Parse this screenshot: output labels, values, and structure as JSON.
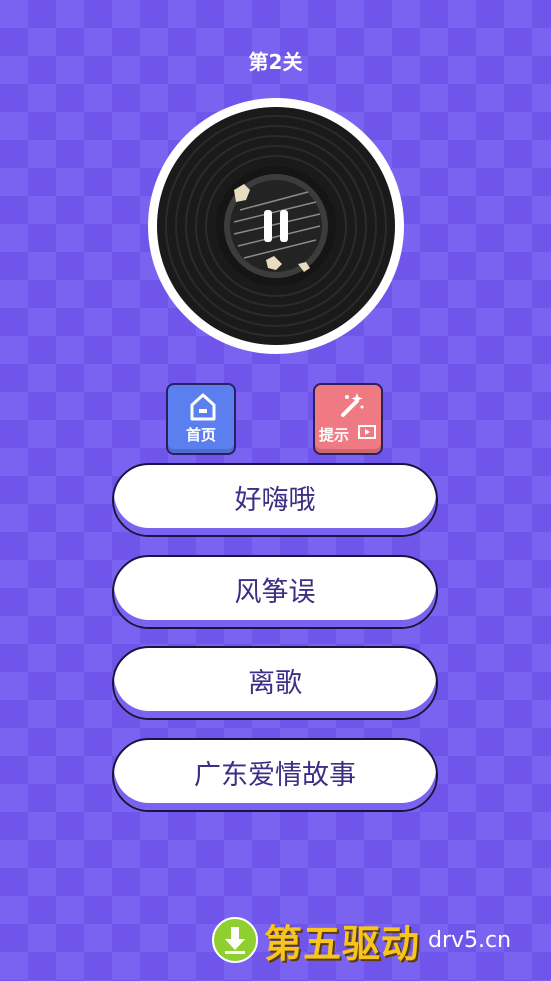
{
  "level_title": "第2关",
  "buttons": {
    "home_label": "首页",
    "hint_label": "提示"
  },
  "answers": [
    "好嗨哦",
    "风筝误",
    "离歌",
    "广东爱情故事"
  ],
  "watermark": {
    "text": "第五驱动",
    "domain": "drv5.cn"
  },
  "colors": {
    "background": "#7b63f2",
    "home_button": "#5c7ff0",
    "hint_button": "#f07a84",
    "answer_text": "#3b2f86"
  },
  "icons": [
    "pause-icon",
    "home-icon",
    "magic-wand-icon",
    "video-icon",
    "download-icon"
  ]
}
